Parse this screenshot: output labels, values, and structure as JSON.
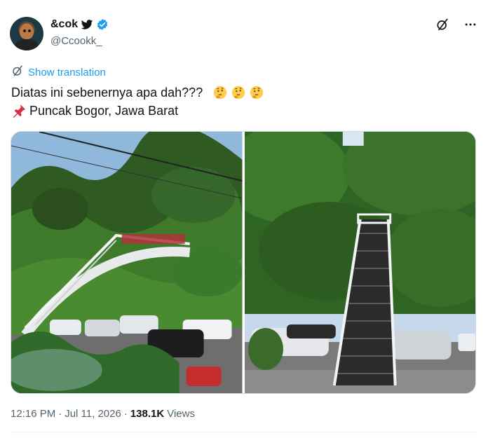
{
  "author": {
    "display_name": "&cok",
    "handle": "@Ccookk_"
  },
  "translate_label": "Show translation",
  "tweet": {
    "line1": "Diatas ini sebenernya apa dah???",
    "line2": "Puncak Bogor, Jawa Barat"
  },
  "media": {
    "photos": [
      "bridge-stair-photo-1",
      "bridge-stair-photo-2"
    ]
  },
  "meta": {
    "time": "12:16 PM",
    "date": "Jul 11, 2026",
    "separator": "·",
    "views_count": "138.1K",
    "views_label": "Views"
  },
  "colors": {
    "accent": "#1d9bf0",
    "text": "#0f1419",
    "muted": "#536471"
  },
  "icons": [
    "verified-badge-icon",
    "bird-icon",
    "grok-icon",
    "more-icon",
    "translate-icon",
    "thinking-face-emoji",
    "pushpin-emoji"
  ]
}
